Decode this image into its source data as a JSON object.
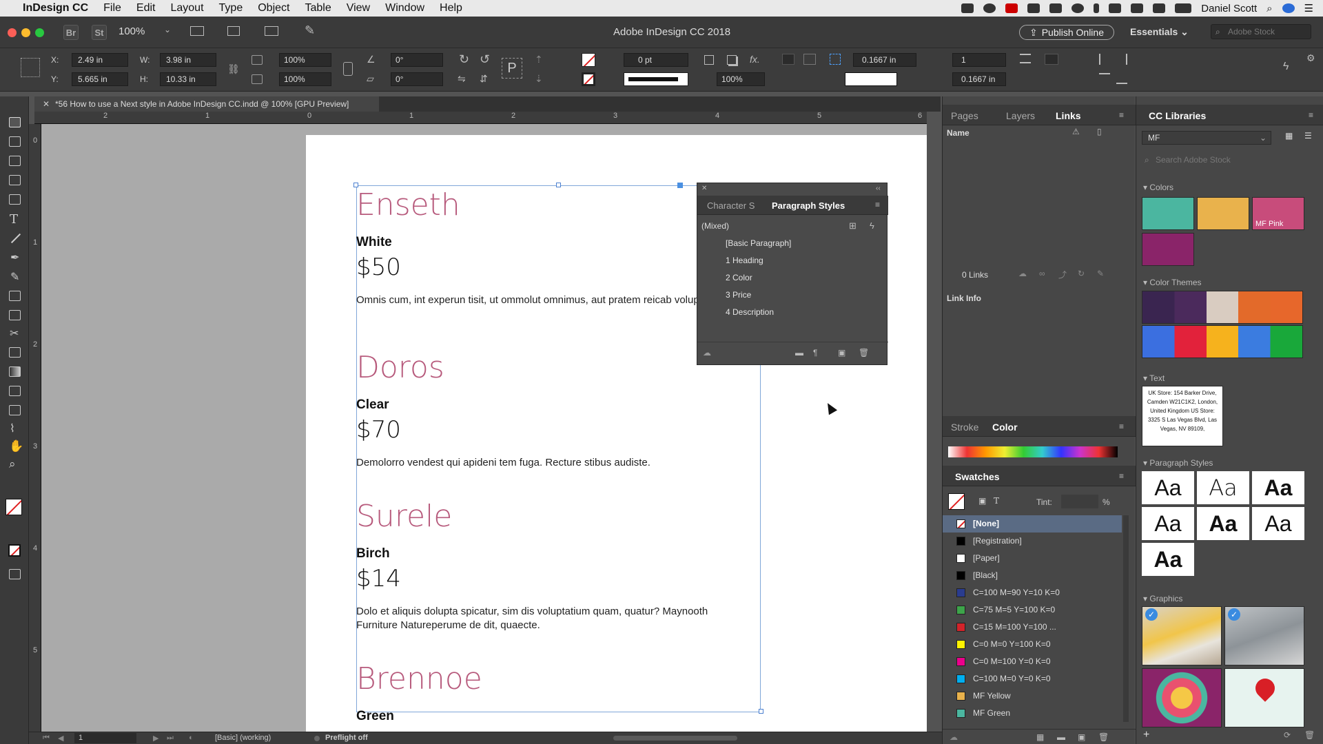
{
  "menubar": {
    "app": "InDesign CC",
    "items": [
      "File",
      "Edit",
      "Layout",
      "Type",
      "Object",
      "Table",
      "View",
      "Window",
      "Help"
    ],
    "user": "Daniel Scott"
  },
  "appbar": {
    "zoom": "100%",
    "title": "Adobe InDesign CC 2018",
    "publish": "Publish Online",
    "workspace": "Essentials",
    "stock_placeholder": "Adobe Stock",
    "br": "Br",
    "st": "St"
  },
  "control": {
    "x": "2.49 in",
    "y": "5.665 in",
    "w": "3.98 in",
    "h": "10.33 in",
    "scale_x": "100%",
    "scale_y": "100%",
    "rotate": "0°",
    "shear": "0°",
    "stroke_weight": "0 pt",
    "opacity": "100%",
    "gutter_1": "0.1667 in",
    "gutter_2": "0.1667 in",
    "columns": "1",
    "x_label": "X:",
    "y_label": "Y:",
    "w_label": "W:",
    "h_label": "H:"
  },
  "document": {
    "tab": "*56 How to use a Next style in Adobe InDesign CC.indd @ 100% [GPU Preview]"
  },
  "ruler": {
    "h": [
      "2",
      "1",
      "0",
      "1",
      "2",
      "3",
      "4",
      "5",
      "6"
    ],
    "v": [
      "0",
      "1",
      "2",
      "3",
      "4",
      "5"
    ]
  },
  "items": [
    {
      "name": "Enseth",
      "color": "White",
      "price": "$50",
      "desc": "Omnis cum, int experun tisit, ut ommolut omnimus, aut pratem reicab voluptatis."
    },
    {
      "name": "Doros",
      "color": "Clear",
      "price": "$70",
      "desc": "Demolorro vendest qui apideni tem fuga. Recture stibus audiste."
    },
    {
      "name": "Surele",
      "color": "Birch",
      "price": "$14",
      "desc": "Dolo et aliquis dolupta spicatur, sim dis voluptatium quam, quatur? Maynooth Furniture Natureperume de dit, quaecte."
    },
    {
      "name": "Brennoe",
      "color": "Green",
      "price": "",
      "desc": ""
    }
  ],
  "para_panel": {
    "tab1": "Character S",
    "tab2": "Paragraph Styles",
    "current": "(Mixed)",
    "styles": [
      "[Basic Paragraph]",
      "1 Heading",
      "2 Color",
      "3 Price",
      "4 Description"
    ]
  },
  "links_panel": {
    "tabs": [
      "Pages",
      "Layers",
      "Links"
    ],
    "name_header": "Name",
    "count": "0 Links",
    "link_info": "Link Info"
  },
  "color_panel": {
    "tabs": [
      "Stroke",
      "Color"
    ]
  },
  "swatches": {
    "title": "Swatches",
    "tint_label": "Tint:",
    "pct": "%",
    "rows": [
      {
        "name": "[None]",
        "color": "#ffffff"
      },
      {
        "name": "[Registration]",
        "color": "#000000"
      },
      {
        "name": "[Paper]",
        "color": "#ffffff"
      },
      {
        "name": "[Black]",
        "color": "#000000"
      },
      {
        "name": "C=100 M=90 Y=10 K=0",
        "color": "#2a3c8f"
      },
      {
        "name": "C=75 M=5 Y=100 K=0",
        "color": "#3da44a"
      },
      {
        "name": "C=15 M=100 Y=100 ...",
        "color": "#d2232a"
      },
      {
        "name": "C=0 M=0 Y=100 K=0",
        "color": "#fff200"
      },
      {
        "name": "C=0 M=100 Y=0 K=0",
        "color": "#ec008c"
      },
      {
        "name": "C=100 M=0 Y=0 K=0",
        "color": "#00aeef"
      },
      {
        "name": "MF Yellow",
        "color": "#e9b24c"
      },
      {
        "name": "MF Green",
        "color": "#4bb6a0"
      }
    ]
  },
  "cc_libraries": {
    "title": "CC Libraries",
    "library": "MF",
    "search_placeholder": "Search Adobe Stock",
    "colors_label": "Colors",
    "mf_pink": "MF Pink",
    "themes_label": "Color Themes",
    "text_label": "Text",
    "text_snippet": "UK Store: 154 Barker Drive, Camden W21C1K2, London, United Kingdom US Store: 3325 S Las Vegas Blvd, Las Vegas, NV 89109,",
    "pstyles_label": "Paragraph Styles",
    "aa": "Aa",
    "graphics_label": "Graphics"
  },
  "statusbar": {
    "page": "1",
    "style": "[Basic] (working)",
    "preflight": "Preflight off"
  }
}
